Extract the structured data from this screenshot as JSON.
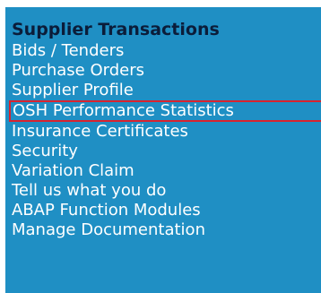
{
  "nav": {
    "heading": "Supplier Transactions",
    "items": [
      {
        "label": "Bids / Tenders"
      },
      {
        "label": "Purchase Orders"
      },
      {
        "label": "Supplier Profile"
      },
      {
        "label": "OSH Performance Statistics",
        "selected": true
      },
      {
        "label": "Insurance Certificates"
      },
      {
        "label": "Security"
      },
      {
        "label": "Variation Claim"
      },
      {
        "label": "Tell us what you do"
      },
      {
        "label": "ABAP Function Modules"
      },
      {
        "label": "Manage Documentation"
      }
    ]
  },
  "colors": {
    "panel_background": "#1f8fc4",
    "heading_text": "#0b1d3a",
    "item_text": "#ffffff",
    "selected_border": "#d8232f"
  }
}
